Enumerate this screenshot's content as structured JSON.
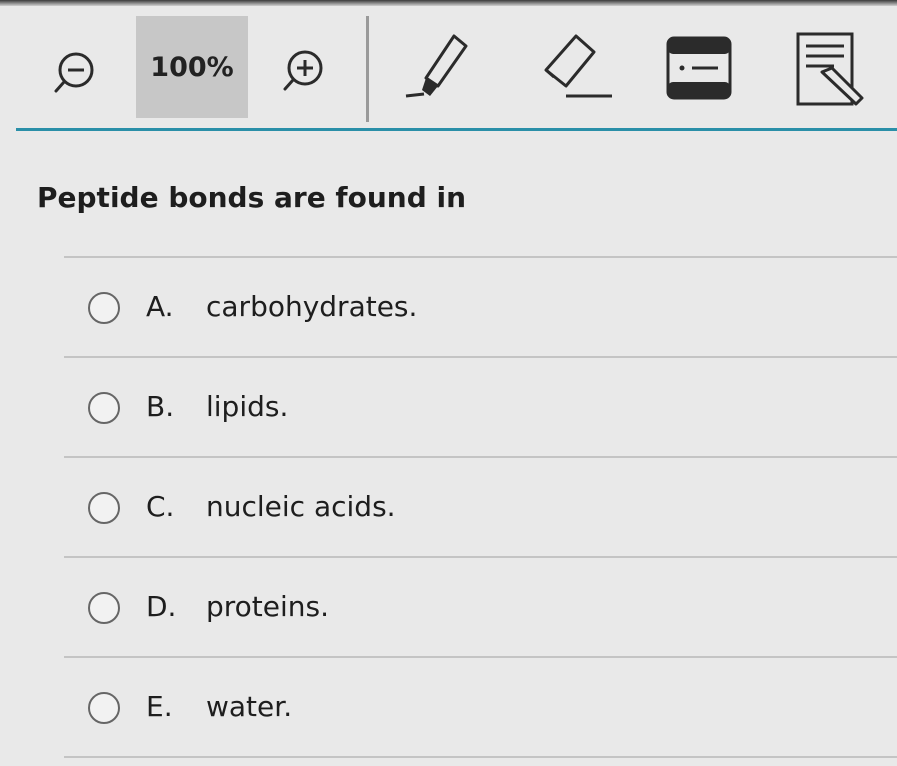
{
  "toolbar": {
    "zoom_level": "100%",
    "tools": [
      {
        "name": "zoom-out",
        "icon": "zoom-out-icon"
      },
      {
        "name": "zoom-in",
        "icon": "zoom-in-icon"
      },
      {
        "name": "highlighter",
        "icon": "pen-icon"
      },
      {
        "name": "eraser",
        "icon": "eraser-icon"
      },
      {
        "name": "answer-masking",
        "icon": "line-reader-icon"
      },
      {
        "name": "notepad",
        "icon": "notepad-pencil-icon"
      }
    ],
    "accent_color": "#2a8fa8"
  },
  "question": {
    "stem": "Peptide bonds are found in",
    "options": [
      {
        "letter": "A.",
        "text": "carbohydrates."
      },
      {
        "letter": "B.",
        "text": "lipids."
      },
      {
        "letter": "C.",
        "text": "nucleic acids."
      },
      {
        "letter": "D.",
        "text": "proteins."
      },
      {
        "letter": "E.",
        "text": "water."
      }
    ]
  }
}
